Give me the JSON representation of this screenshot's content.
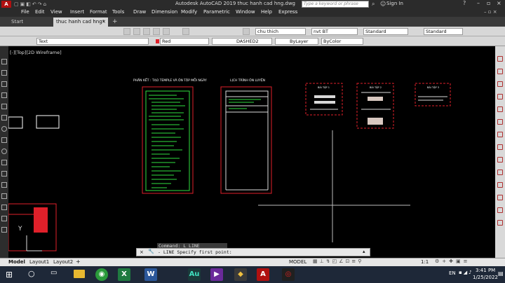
{
  "app": {
    "title": "Autodesk AutoCAD 2019   thuc hanh cad hng.dwg",
    "search_placeholder": "Type a keyword or phrase",
    "sign_in": "Sign In"
  },
  "menu": [
    "File",
    "Edit",
    "View",
    "Insert",
    "Format",
    "Tools",
    "Draw",
    "Dimension",
    "Modify",
    "Parametric",
    "Window",
    "Help",
    "Express"
  ],
  "tabs": {
    "start": "Start",
    "file": "thuc hanh cad hng*"
  },
  "toolbar1": {
    "layer_name": "chu thich",
    "dimstyle": "nvt BT",
    "style1": "Standard",
    "style2": "Standard"
  },
  "toolbar2": {
    "text_style": "Text",
    "color": "Red",
    "linetype": "DASHED2",
    "lineweight": "ByLayer",
    "plotstyle": "ByColor"
  },
  "viewport_label": "[-][Top][2D Wireframe]",
  "drawing": {
    "title_left": "PHẦN KẾT : TẠO TEMPLE VÀ ÔN TẬP MỖI NGÀY",
    "title_mid": "LỊCH TRÌNH ÔN LUYỆN",
    "sheet_title_1": "BÀI TẬP 1",
    "sheet_title_2": "BÀI TẬP 2",
    "sheet_title_3": "BÀI TẬP 3",
    "ucs_y": "Y"
  },
  "command": {
    "history": "Command: L LINE",
    "prompt": "- LINE Specify first point:"
  },
  "layout_tabs": [
    "Model",
    "Layout1",
    "Layout2"
  ],
  "status": {
    "model": "MODEL",
    "scale": "1:1"
  },
  "taskbar": {
    "lang": "EN",
    "time": "3:41 PM",
    "date": "1/25/2022"
  },
  "colors": {
    "red": "#e0202a",
    "green": "#30e040",
    "cad_bg": "#000000"
  }
}
